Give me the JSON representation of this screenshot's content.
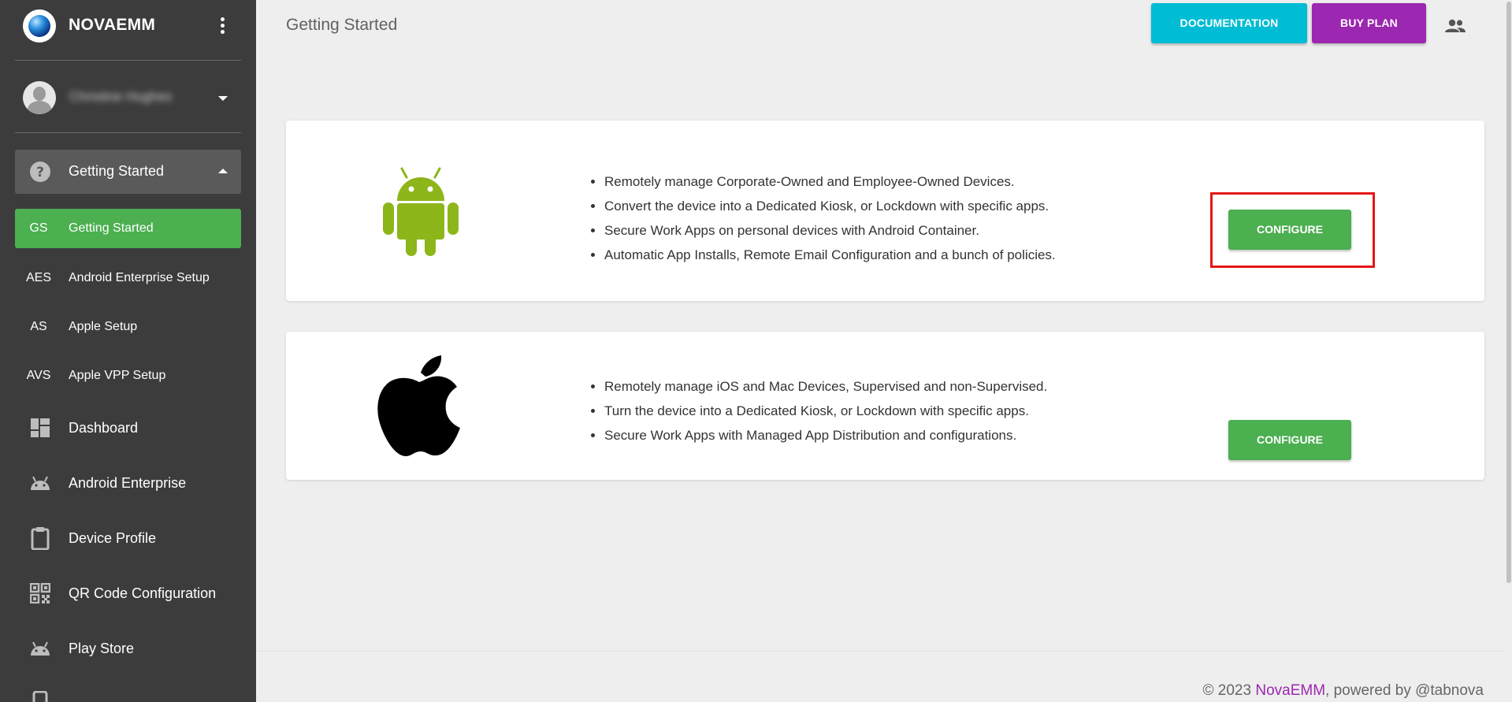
{
  "brand": {
    "name": "NOVAEMM"
  },
  "user": {
    "name": "Christine Hughes"
  },
  "sidebar": {
    "section": {
      "label": "Getting Started"
    },
    "subitems": [
      {
        "abbr": "GS",
        "label": "Getting Started"
      },
      {
        "abbr": "AES",
        "label": "Android Enterprise Setup"
      },
      {
        "abbr": "AS",
        "label": "Apple Setup"
      },
      {
        "abbr": "AVS",
        "label": "Apple VPP Setup"
      }
    ],
    "items": [
      {
        "label": "Dashboard"
      },
      {
        "label": "Android Enterprise"
      },
      {
        "label": "Device Profile"
      },
      {
        "label": "QR Code Configuration"
      },
      {
        "label": "Play Store"
      }
    ]
  },
  "header": {
    "title": "Getting Started",
    "documentation_label": "DOCUMENTATION",
    "buy_plan_label": "BUY PLAN"
  },
  "cards": [
    {
      "bullets": [
        "Remotely manage Corporate-Owned and Employee-Owned Devices.",
        "Convert the device into a Dedicated Kiosk, or Lockdown with specific apps.",
        "Secure Work Apps on personal devices with Android Container.",
        "Automatic App Installs, Remote Email Configuration and a bunch of policies."
      ],
      "button_label": "CONFIGURE"
    },
    {
      "bullets": [
        "Remotely manage iOS and Mac Devices, Supervised and non-Supervised.",
        "Turn the device into a Dedicated Kiosk, or Lockdown with specific apps.",
        "Secure Work Apps with Managed App Distribution and configurations."
      ],
      "button_label": "CONFIGURE"
    }
  ],
  "footer": {
    "prefix": "© 2023 ",
    "brand": "NovaEMM",
    "suffix": ", powered by @tabnova"
  },
  "colors": {
    "sidebar_bg": "#3c3c3c",
    "active_green": "#4caf50",
    "documentation": "#00bcd4",
    "buy_plan": "#9c27b0",
    "highlight": "#e51616"
  }
}
